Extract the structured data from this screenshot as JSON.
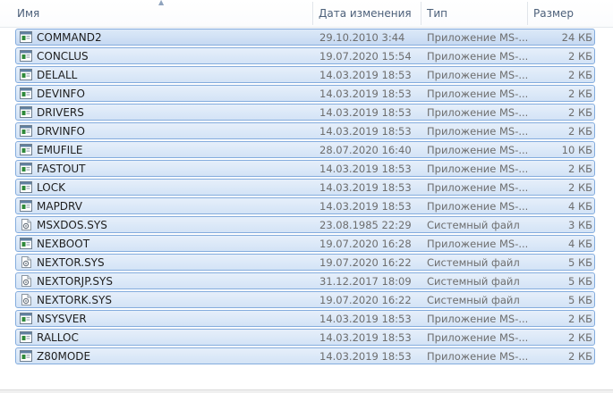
{
  "columns": {
    "name": "Имя",
    "date": "Дата изменения",
    "type": "Тип",
    "size": "Размер"
  },
  "files": [
    {
      "name": "COMMAND2",
      "date": "29.10.2010 3:44",
      "type": "Приложение MS-...",
      "size": "24 КБ",
      "icon": "ms-dos-app-icon"
    },
    {
      "name": "CONCLUS",
      "date": "19.07.2020 15:54",
      "type": "Приложение MS-...",
      "size": "2 КБ",
      "icon": "ms-dos-app-icon"
    },
    {
      "name": "DELALL",
      "date": "14.03.2019 18:53",
      "type": "Приложение MS-...",
      "size": "2 КБ",
      "icon": "ms-dos-app-icon"
    },
    {
      "name": "DEVINFO",
      "date": "14.03.2019 18:53",
      "type": "Приложение MS-...",
      "size": "2 КБ",
      "icon": "ms-dos-app-icon"
    },
    {
      "name": "DRIVERS",
      "date": "14.03.2019 18:53",
      "type": "Приложение MS-...",
      "size": "2 КБ",
      "icon": "ms-dos-app-icon"
    },
    {
      "name": "DRVINFO",
      "date": "14.03.2019 18:53",
      "type": "Приложение MS-...",
      "size": "2 КБ",
      "icon": "ms-dos-app-icon"
    },
    {
      "name": "EMUFILE",
      "date": "28.07.2020 16:40",
      "type": "Приложение MS-...",
      "size": "10 КБ",
      "icon": "ms-dos-app-icon"
    },
    {
      "name": "FASTOUT",
      "date": "14.03.2019 18:53",
      "type": "Приложение MS-...",
      "size": "2 КБ",
      "icon": "ms-dos-app-icon"
    },
    {
      "name": "LOCK",
      "date": "14.03.2019 18:53",
      "type": "Приложение MS-...",
      "size": "2 КБ",
      "icon": "ms-dos-app-icon"
    },
    {
      "name": "MAPDRV",
      "date": "14.03.2019 18:53",
      "type": "Приложение MS-...",
      "size": "4 КБ",
      "icon": "ms-dos-app-icon"
    },
    {
      "name": "MSXDOS.SYS",
      "date": "23.08.1985 22:29",
      "type": "Системный файл",
      "size": "3 КБ",
      "icon": "system-file-icon"
    },
    {
      "name": "NEXBOOT",
      "date": "19.07.2020 16:28",
      "type": "Приложение MS-...",
      "size": "4 КБ",
      "icon": "ms-dos-app-icon"
    },
    {
      "name": "NEXTOR.SYS",
      "date": "19.07.2020 16:22",
      "type": "Системный файл",
      "size": "5 КБ",
      "icon": "system-file-icon"
    },
    {
      "name": "NEXTORJP.SYS",
      "date": "31.12.2017 18:09",
      "type": "Системный файл",
      "size": "5 КБ",
      "icon": "system-file-icon"
    },
    {
      "name": "NEXTORK.SYS",
      "date": "19.07.2020 16:22",
      "type": "Системный файл",
      "size": "5 КБ",
      "icon": "system-file-icon"
    },
    {
      "name": "NSYSVER",
      "date": "14.03.2019 18:53",
      "type": "Приложение MS-...",
      "size": "2 КБ",
      "icon": "ms-dos-app-icon"
    },
    {
      "name": "RALLOC",
      "date": "14.03.2019 18:53",
      "type": "Приложение MS-...",
      "size": "2 КБ",
      "icon": "ms-dos-app-icon"
    },
    {
      "name": "Z80MODE",
      "date": "14.03.2019 18:53",
      "type": "Приложение MS-...",
      "size": "2 КБ",
      "icon": "ms-dos-app-icon"
    }
  ],
  "colors": {
    "selection_fill": "#d9e7f8",
    "selection_border": "#84acdd",
    "header_text": "#4c607a",
    "secondary_text": "#6d6d6d"
  }
}
